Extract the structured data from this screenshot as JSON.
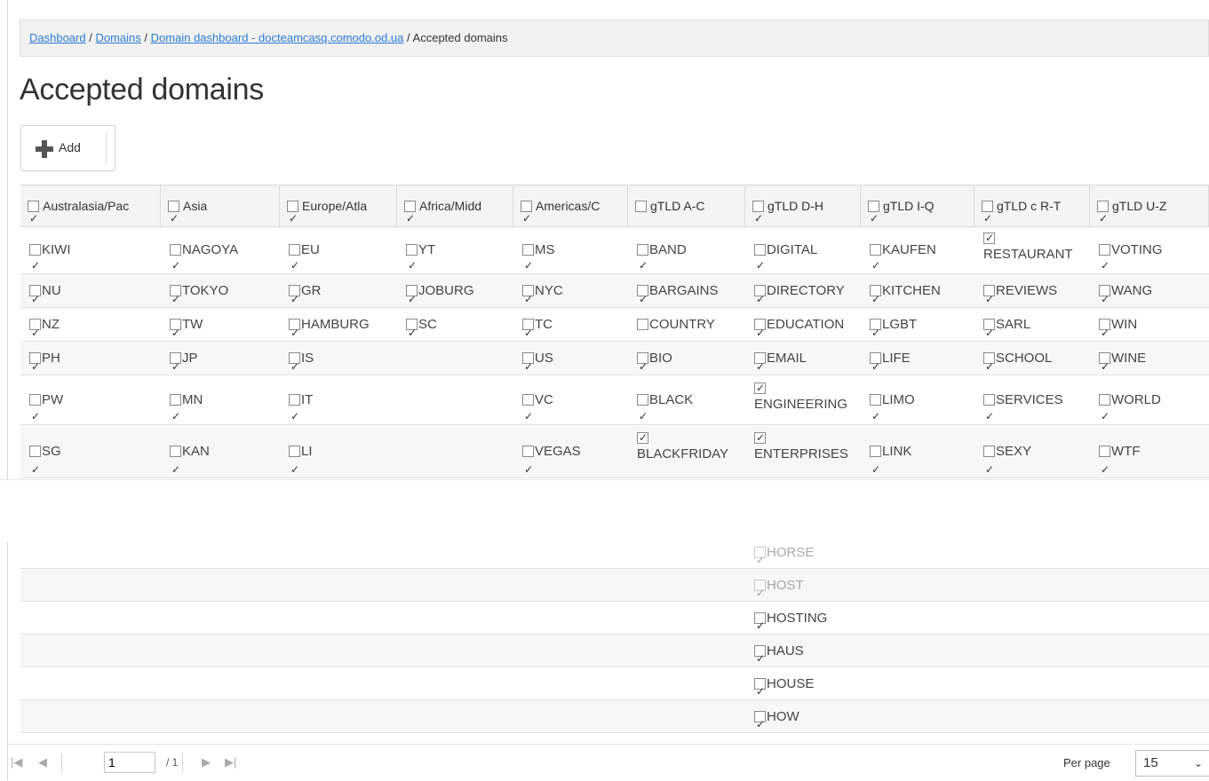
{
  "breadcrumb": {
    "dashboard": "Dashboard",
    "domains": "Domains",
    "domain_dashboard": "Domain dashboard - docteamcasq.comodo.od.ua",
    "current": "Accepted domains",
    "sep": "/"
  },
  "page_title": "Accepted domains",
  "toolbar": {
    "add_label": "Add"
  },
  "columns": [
    {
      "label": "Australasia/Pac",
      "checked": true
    },
    {
      "label": "Asia",
      "checked": true
    },
    {
      "label": "Europe/Atla",
      "checked": true
    },
    {
      "label": "Africa/Midd",
      "checked": true
    },
    {
      "label": "Americas/C",
      "checked": true
    },
    {
      "label": "gTLD A-C",
      "checked": false
    },
    {
      "label": "gTLD D-H",
      "checked": true
    },
    {
      "label": "gTLD I-Q",
      "checked": true
    },
    {
      "label": "gTLD c R-T",
      "checked": true
    },
    {
      "label": "gTLD U-Z",
      "checked": true
    }
  ],
  "rows": [
    [
      {
        "t": "KIWI",
        "c": true
      },
      {
        "t": "NAGOYA",
        "c": true
      },
      {
        "t": "EU",
        "c": true
      },
      {
        "t": "YT",
        "c": true
      },
      {
        "t": "MS",
        "c": true
      },
      {
        "t": "BAND",
        "c": true
      },
      {
        "t": "DIGITAL",
        "c": true
      },
      {
        "t": "KAUFEN",
        "c": true
      },
      {
        "t": "RESTAURANT",
        "c": true
      },
      {
        "t": "VOTING",
        "c": true
      }
    ],
    [
      {
        "t": "NU",
        "c": true
      },
      {
        "t": "TOKYO",
        "c": true
      },
      {
        "t": "GR",
        "c": true
      },
      {
        "t": "JOBURG",
        "c": true
      },
      {
        "t": "NYC",
        "c": true
      },
      {
        "t": "BARGAINS",
        "c": true
      },
      {
        "t": "DIRECTORY",
        "c": true
      },
      {
        "t": "KITCHEN",
        "c": true
      },
      {
        "t": "REVIEWS",
        "c": true
      },
      {
        "t": "WANG",
        "c": true
      }
    ],
    [
      {
        "t": "NZ",
        "c": true
      },
      {
        "t": "TW",
        "c": true
      },
      {
        "t": "HAMBURG",
        "c": true
      },
      {
        "t": "SC",
        "c": true
      },
      {
        "t": "TC",
        "c": true
      },
      {
        "t": "COUNTRY",
        "c": false
      },
      {
        "t": "EDUCATION",
        "c": true
      },
      {
        "t": "LGBT",
        "c": true
      },
      {
        "t": "SARL",
        "c": true
      },
      {
        "t": "WIN",
        "c": true
      }
    ],
    [
      {
        "t": "PH",
        "c": true
      },
      {
        "t": "JP",
        "c": true
      },
      {
        "t": "IS",
        "c": true
      },
      null,
      {
        "t": "US",
        "c": true
      },
      {
        "t": "BIO",
        "c": true
      },
      {
        "t": "EMAIL",
        "c": true
      },
      {
        "t": "LIFE",
        "c": true
      },
      {
        "t": "SCHOOL",
        "c": true
      },
      {
        "t": "WINE",
        "c": true
      }
    ],
    [
      {
        "t": "PW",
        "c": true
      },
      {
        "t": "MN",
        "c": true
      },
      {
        "t": "IT",
        "c": true
      },
      null,
      {
        "t": "VC",
        "c": true
      },
      {
        "t": "BLACK",
        "c": true
      },
      {
        "t": "ENGINEERING",
        "c": true
      },
      {
        "t": "LIMO",
        "c": true
      },
      {
        "t": "SERVICES",
        "c": true
      },
      {
        "t": "WORLD",
        "c": true
      }
    ],
    [
      {
        "t": "SG",
        "c": true
      },
      {
        "t": "KAN",
        "c": true
      },
      {
        "t": "LI",
        "c": true
      },
      null,
      {
        "t": "VEGAS",
        "c": true
      },
      {
        "t": "BLACKFRIDAY",
        "c": true
      },
      {
        "t": "ENTERPRISES",
        "c": true
      },
      {
        "t": "LINK",
        "c": true
      },
      {
        "t": "SEXY",
        "c": true
      },
      {
        "t": "WTF",
        "c": true
      }
    ]
  ],
  "lower_rows": [
    {
      "t": "HORSE",
      "c": true
    },
    {
      "t": "HOST",
      "c": true
    },
    {
      "t": "HOSTING",
      "c": true
    },
    {
      "t": "HAUS",
      "c": true
    },
    {
      "t": "HOUSE",
      "c": true
    },
    {
      "t": "HOW",
      "c": true
    }
  ],
  "pager": {
    "page": "1",
    "total": "/ 1",
    "per_page_label": "Per page",
    "per_page_value": "15",
    "first_icon": "first-page-icon",
    "prev_icon": "prev-page-icon",
    "next_icon": "next-page-icon",
    "last_icon": "last-page-icon"
  },
  "colors": {
    "link": "#2a7bd4",
    "header_bg": "#f4f4f4",
    "alt_row": "#f7f7f7"
  }
}
